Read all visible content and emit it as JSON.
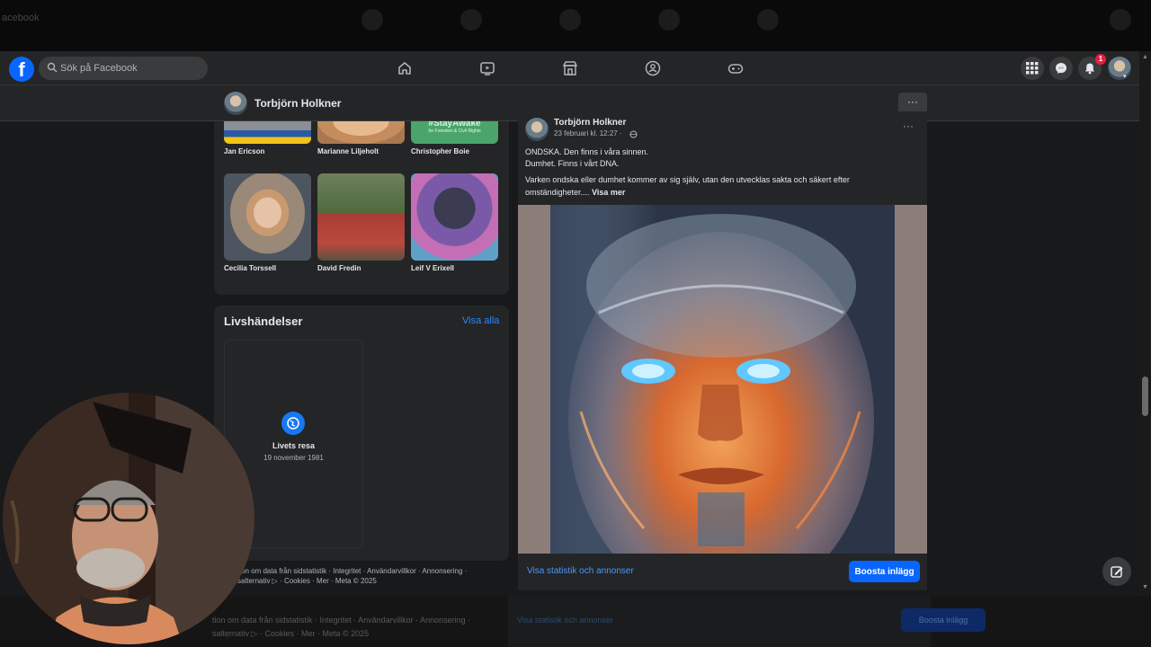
{
  "colors": {
    "accent": "#0866ff",
    "link": "#4599ff",
    "badge": "#e41e3f",
    "surface": "#242526",
    "page_bg": "#18191a"
  },
  "top_strip": {
    "ghost_text": "acebook"
  },
  "header": {
    "logo_icon": "facebook-logo-icon",
    "search": {
      "placeholder": "Sök på Facebook",
      "value": ""
    },
    "nav_icons": [
      "home-icon",
      "video-icon",
      "marketplace-icon",
      "groups-icon",
      "gaming-icon"
    ],
    "notifications_badge": "1"
  },
  "profile_header": {
    "name": "Torbjörn Holkner",
    "more_label": "···"
  },
  "friends": [
    {
      "name": "Jan Ericson"
    },
    {
      "name": "Marianne Liljeholt"
    },
    {
      "name": "Christopher Boie",
      "thumb_text": "#StayAwake",
      "thumb_sub": "for Freedom & Civil Rights"
    },
    {
      "name": "Cecilia Torssell"
    },
    {
      "name": "David Fredin"
    },
    {
      "name": "Leif V Erixell"
    }
  ],
  "life_events": {
    "title": "Livshändelser",
    "see_all": "Visa alla",
    "event_name": "Livets resa",
    "event_date": "19 november 1981"
  },
  "footer": {
    "line1": "tion om data från sidstatistik · Integritet · Användarvillkor · Annonsering ·",
    "line2": "salternativ ▷ · Cookies · Mer · Meta © 2025"
  },
  "post": {
    "author": "Torbjörn Holkner",
    "date": "23 februari kl. 12:27 ·",
    "more": "···",
    "line1": "ONDSKA. Den finns i våra sinnen.",
    "line2": "Dumhet. Finns i vårt DNA.",
    "line3": "Varken ondska eller dumhet kommer av sig själv, utan den utvecklas sakta och säkert efter",
    "line4": "omständigheter....",
    "see_more": "Visa mer",
    "stats_link": "Visa statistik och annonser",
    "boost_label": "Boosta inlägg"
  },
  "bottom_ghost": {
    "line1": "tion om data från sidstatistik · Integritet · Användarvillkor · Annonsering ·",
    "line2": "salternativ ▷ · Cookies · Mer · Meta © 2025",
    "stats": "Visa statistik och annonser",
    "boost": "Boosta inlägg"
  }
}
